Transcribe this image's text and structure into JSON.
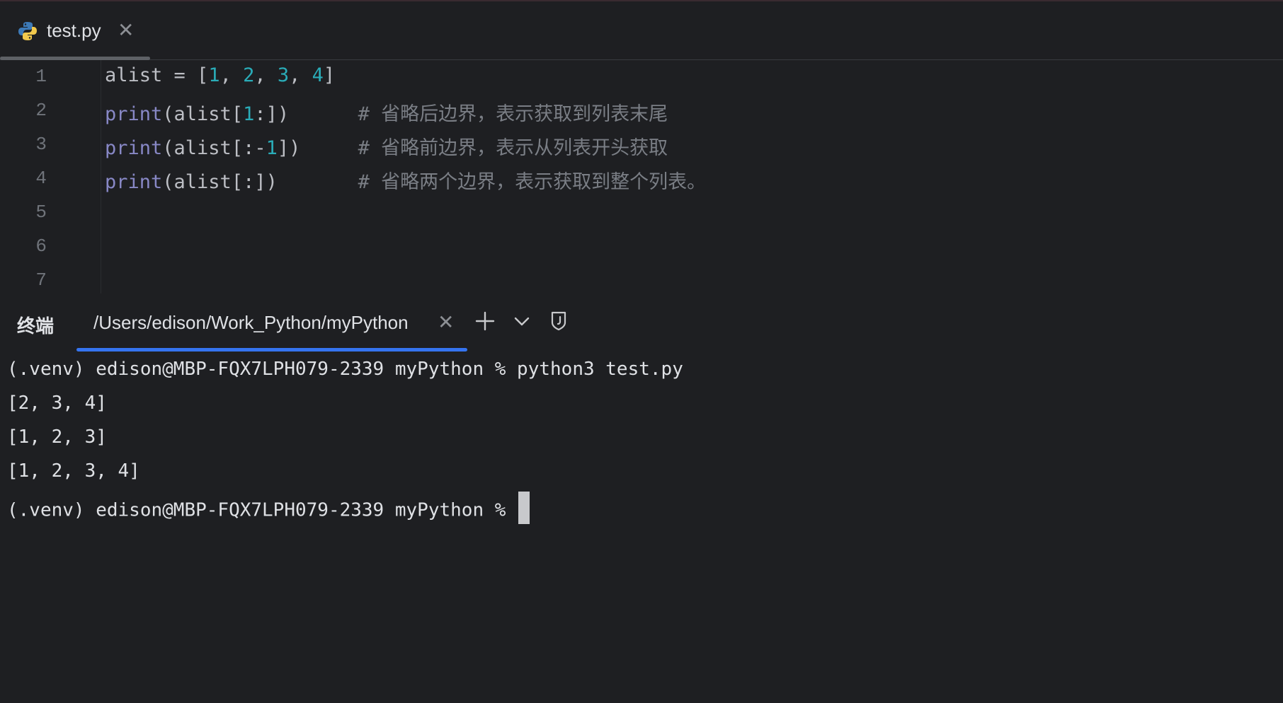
{
  "editor": {
    "tab": {
      "filename": "test.py"
    },
    "line_numbers": [
      "1",
      "2",
      "3",
      "4",
      "5",
      "6",
      "7"
    ],
    "lines": [
      [
        {
          "t": "alist = [",
          "c": "plain"
        },
        {
          "t": "1",
          "c": "num"
        },
        {
          "t": ", ",
          "c": "plain"
        },
        {
          "t": "2",
          "c": "num"
        },
        {
          "t": ", ",
          "c": "plain"
        },
        {
          "t": "3",
          "c": "num"
        },
        {
          "t": ", ",
          "c": "plain"
        },
        {
          "t": "4",
          "c": "num"
        },
        {
          "t": "]",
          "c": "plain"
        }
      ],
      [
        {
          "t": "print",
          "c": "kw"
        },
        {
          "t": "(alist[",
          "c": "plain"
        },
        {
          "t": "1",
          "c": "num"
        },
        {
          "t": ":])      ",
          "c": "plain"
        },
        {
          "t": "# 省略后边界，表示获取到列表末尾",
          "c": "cmt"
        }
      ],
      [
        {
          "t": "print",
          "c": "kw"
        },
        {
          "t": "(alist[:-",
          "c": "plain"
        },
        {
          "t": "1",
          "c": "num"
        },
        {
          "t": "])     ",
          "c": "plain"
        },
        {
          "t": "# 省略前边界，表示从列表开头获取",
          "c": "cmt"
        }
      ],
      [
        {
          "t": "print",
          "c": "kw"
        },
        {
          "t": "(alist[:])       ",
          "c": "plain"
        },
        {
          "t": "# 省略两个边界，表示获取到整个列表。",
          "c": "cmt"
        }
      ]
    ]
  },
  "terminal": {
    "title": "终端",
    "tab_label": "/Users/edison/Work_Python/myPython",
    "output": [
      "(.venv) edison@MBP-FQX7LPH079-2339 myPython % python3 test.py",
      "[2, 3, 4]",
      "[1, 2, 3]",
      "[1, 2, 3, 4]"
    ],
    "prompt": "(.venv) edison@MBP-FQX7LPH079-2339 myPython % "
  },
  "icons": {
    "file_tab": "python-file-icon",
    "close": "close-icon",
    "add": "plus-icon",
    "dropdown": "chevron-down-icon",
    "extra": "shield-icon"
  },
  "colors": {
    "background": "#1e1f22",
    "keyword": "#8888c6",
    "number": "#2aacb8",
    "comment": "#7a7e85",
    "active_tab_accent": "#3574f0"
  }
}
